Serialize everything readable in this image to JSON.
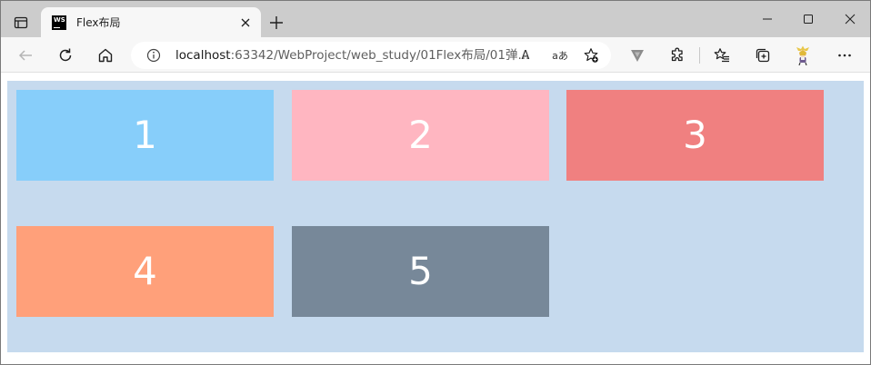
{
  "browser": {
    "tab": {
      "title": "Flex布局",
      "favicon_text": "WS",
      "favicon_icon": "webstorm-icon"
    },
    "address_bar": {
      "url_host": "localhost",
      "url_path": ":63342/WebProject/web_study/01Flex布局/01弹..."
    },
    "toolbar_icons": [
      "back-icon",
      "refresh-icon",
      "home-icon",
      "info-icon",
      "read-aloud-icon",
      "translate-icon",
      "favorite-add-icon",
      "vpn-icon",
      "extensions-icon",
      "favorites-icon",
      "collections-icon",
      "profile-icon",
      "more-icon"
    ],
    "read_aloud_label": "A",
    "translate_label": "aあ",
    "more_label": "···"
  },
  "page": {
    "boxes": [
      {
        "label": "1",
        "color": "#87cefa"
      },
      {
        "label": "2",
        "color": "#ffb6c1"
      },
      {
        "label": "3",
        "color": "#f08080"
      },
      {
        "label": "4",
        "color": "#ffa07a"
      },
      {
        "label": "5",
        "color": "#778899"
      }
    ],
    "container_color": "#c6daee"
  }
}
